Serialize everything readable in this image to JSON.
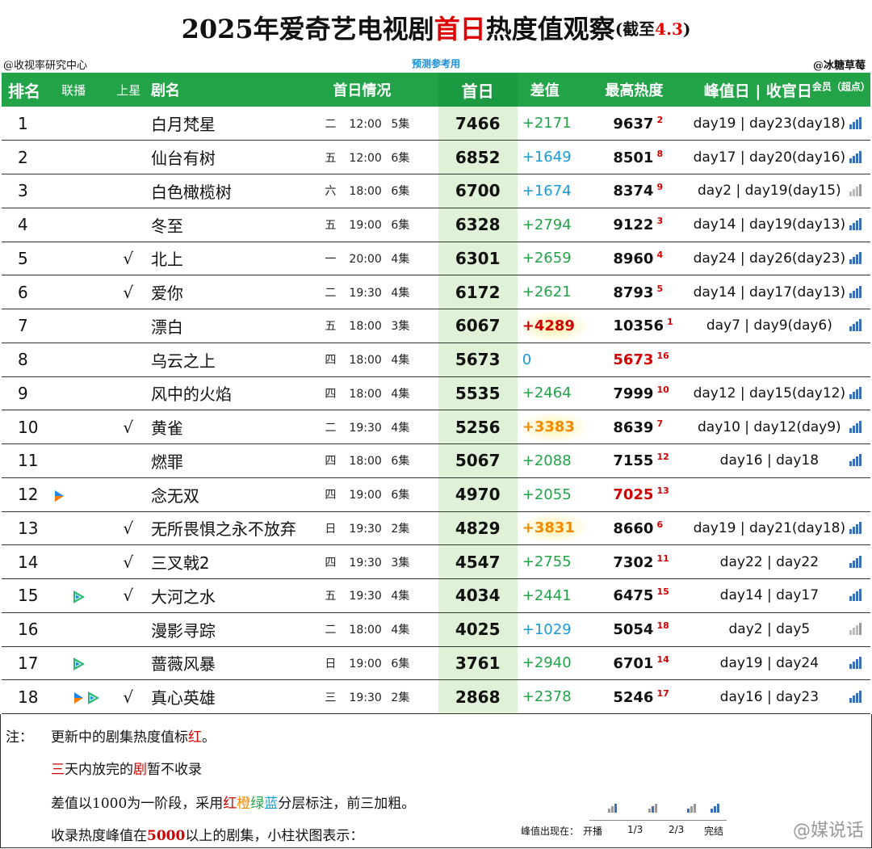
{
  "title": {
    "part1": "2025年爱奇艺电视剧",
    "part2": "首日",
    "part3": "热度值观察",
    "small1": "(截至",
    "small2": "4.3",
    "small3": ")"
  },
  "meta": {
    "left": "@收视率研究中心",
    "center": "预测参考用",
    "right": "@冰糖草莓"
  },
  "headers": {
    "rank": "排名",
    "joint": "联播",
    "satellite": "上星",
    "name": "剧名",
    "sched": "首日情况",
    "first": "首日",
    "diff": "差值",
    "peak": "最高热度",
    "days": "峰值日 | 收官日",
    "member": "会员（超点）"
  },
  "rows": [
    {
      "rank": "1",
      "joint": "",
      "sat": "",
      "name": "白月梵星",
      "wd": "二",
      "tm": "12:00",
      "ep": "5集",
      "first": "7466",
      "diff": "+2171",
      "diffc": "green",
      "peak": "9637",
      "pr": "2",
      "peakc": "",
      "days": "day19 | day23(day18)",
      "bar": 3
    },
    {
      "rank": "2",
      "joint": "",
      "sat": "",
      "name": "仙台有树",
      "wd": "五",
      "tm": "12:00",
      "ep": "6集",
      "first": "6852",
      "diff": "+1649",
      "diffc": "blue",
      "peak": "8501",
      "pr": "8",
      "peakc": "",
      "days": "day17 | day20(day16)",
      "bar": 3
    },
    {
      "rank": "3",
      "joint": "",
      "sat": "",
      "name": "白色橄榄树",
      "wd": "六",
      "tm": "18:00",
      "ep": "6集",
      "first": "6700",
      "diff": "+1674",
      "diffc": "blue",
      "peak": "8374",
      "pr": "9",
      "peakc": "",
      "days": "day2 | day19(day15)",
      "bar": 0
    },
    {
      "rank": "4",
      "joint": "",
      "sat": "",
      "name": "冬至",
      "wd": "五",
      "tm": "19:00",
      "ep": "6集",
      "first": "6328",
      "diff": "+2794",
      "diffc": "green",
      "peak": "9122",
      "pr": "3",
      "peakc": "",
      "days": "day14 | day19(day13)",
      "bar": 3
    },
    {
      "rank": "5",
      "joint": "",
      "sat": "√",
      "name": "北上",
      "wd": "一",
      "tm": "20:00",
      "ep": "4集",
      "first": "6301",
      "diff": "+2659",
      "diffc": "green",
      "peak": "8960",
      "pr": "4",
      "peakc": "",
      "days": "day24 | day26(day23)",
      "bar": 3
    },
    {
      "rank": "6",
      "joint": "",
      "sat": "√",
      "name": "爱你",
      "wd": "二",
      "tm": "19:30",
      "ep": "4集",
      "first": "6172",
      "diff": "+2621",
      "diffc": "green",
      "peak": "8793",
      "pr": "5",
      "peakc": "",
      "days": "day14 | day17(day13)",
      "bar": 3
    },
    {
      "rank": "7",
      "joint": "",
      "sat": "",
      "name": "漂白",
      "wd": "五",
      "tm": "18:00",
      "ep": "3集",
      "first": "6067",
      "diff": "+4289",
      "diffc": "red-b",
      "peak": "10356",
      "pr": "1",
      "peakc": "",
      "days": "day7 | day9(day6)",
      "bar": 3
    },
    {
      "rank": "8",
      "joint": "",
      "sat": "",
      "name": "乌云之上",
      "wd": "四",
      "tm": "18:00",
      "ep": "4集",
      "first": "5673",
      "diff": "0",
      "diffc": "blue",
      "peak": "5673",
      "pr": "16",
      "peakc": "red",
      "days": "",
      "bar": -1
    },
    {
      "rank": "9",
      "joint": "",
      "sat": "",
      "name": "风中的火焰",
      "wd": "四",
      "tm": "18:00",
      "ep": "4集",
      "first": "5535",
      "diff": "+2464",
      "diffc": "green",
      "peak": "7999",
      "pr": "10",
      "peakc": "",
      "days": "day12 | day15(day12)",
      "bar": 3
    },
    {
      "rank": "10",
      "joint": "",
      "sat": "√",
      "name": "黄雀",
      "wd": "二",
      "tm": "19:30",
      "ep": "4集",
      "first": "5256",
      "diff": "+3383",
      "diffc": "orange-b",
      "peak": "8639",
      "pr": "7",
      "peakc": "",
      "days": "day10 | day12(day9)",
      "bar": 3
    },
    {
      "rank": "11",
      "joint": "",
      "sat": "",
      "name": "燃罪",
      "wd": "四",
      "tm": "18:00",
      "ep": "6集",
      "first": "5067",
      "diff": "+2088",
      "diffc": "green",
      "peak": "7155",
      "pr": "12",
      "peakc": "",
      "days": "day16 | day18",
      "bar": 3
    },
    {
      "rank": "12",
      "joint": "i",
      "sat": "",
      "name": "念无双",
      "wd": "四",
      "tm": "19:00",
      "ep": "6集",
      "first": "4970",
      "diff": "+2055",
      "diffc": "green",
      "peak": "7025",
      "pr": "13",
      "peakc": "red",
      "days": "",
      "bar": -1
    },
    {
      "rank": "13",
      "joint": "",
      "sat": "√",
      "name": "无所畏惧之永不放弃",
      "wd": "日",
      "tm": "19:30",
      "ep": "2集",
      "first": "4829",
      "diff": "+3831",
      "diffc": "orange-b",
      "peak": "8660",
      "pr": "6",
      "peakc": "",
      "days": "day19 | day21(day18)",
      "bar": 3
    },
    {
      "rank": "14",
      "joint": "",
      "sat": "√",
      "name": "三叉戟2",
      "wd": "四",
      "tm": "19:30",
      "ep": "3集",
      "first": "4547",
      "diff": "+2755",
      "diffc": "green",
      "peak": "7302",
      "pr": "11",
      "peakc": "",
      "days": "day22 | day22",
      "bar": 3
    },
    {
      "rank": "15",
      "joint": "t",
      "sat": "√",
      "name": "大河之水",
      "wd": "五",
      "tm": "19:30",
      "ep": "4集",
      "first": "4034",
      "diff": "+2441",
      "diffc": "green",
      "peak": "6475",
      "pr": "15",
      "peakc": "",
      "days": "day14 | day17",
      "bar": 3
    },
    {
      "rank": "16",
      "joint": "",
      "sat": "",
      "name": "漫影寻踪",
      "wd": "二",
      "tm": "18:00",
      "ep": "4集",
      "first": "4025",
      "diff": "+1029",
      "diffc": "blue",
      "peak": "5054",
      "pr": "18",
      "peakc": "",
      "days": "day2 | day5",
      "bar": 0
    },
    {
      "rank": "17",
      "joint": "t",
      "sat": "",
      "name": "蔷薇风暴",
      "wd": "日",
      "tm": "19:00",
      "ep": "6集",
      "first": "3761",
      "diff": "+2940",
      "diffc": "green",
      "peak": "6701",
      "pr": "14",
      "peakc": "",
      "days": "day19 | day24",
      "bar": 3
    },
    {
      "rank": "18",
      "joint": "it",
      "sat": "√",
      "name": "真心英雄",
      "wd": "三",
      "tm": "19:30",
      "ep": "2集",
      "first": "2868",
      "diff": "+2378",
      "diffc": "green",
      "peak": "5246",
      "pr": "17",
      "peakc": "",
      "days": "day16 | day23",
      "bar": 3
    }
  ],
  "notes": {
    "label": "注：",
    "line1a": "更新中的剧集热度值标",
    "line1b": "红",
    "line1c": "。",
    "line2a": "三",
    "line2b": "天内放完的",
    "line2c": "剧",
    "line2d": "暂不收录",
    "line3a": "差值以1000为一阶段，采用",
    "line3b": "红",
    "line3c": "橙",
    "line3d": "绿",
    "line3e": "蓝",
    "line3f": "分层标注，前三加粗。",
    "line4a": "收录热度峰值在",
    "line4b": "5000",
    "line4c": "以上的剧集，小柱状图表示：",
    "legend_title": "峰值出现在：",
    "legend": [
      "开播",
      "1/3",
      "2/3",
      "完结"
    ]
  },
  "watermark": "@媒说话",
  "colors": {
    "header_bg": "#22a348",
    "first_col_bg": "#dff1d6",
    "bar": "#3a6fb5",
    "red": "#d00000"
  }
}
